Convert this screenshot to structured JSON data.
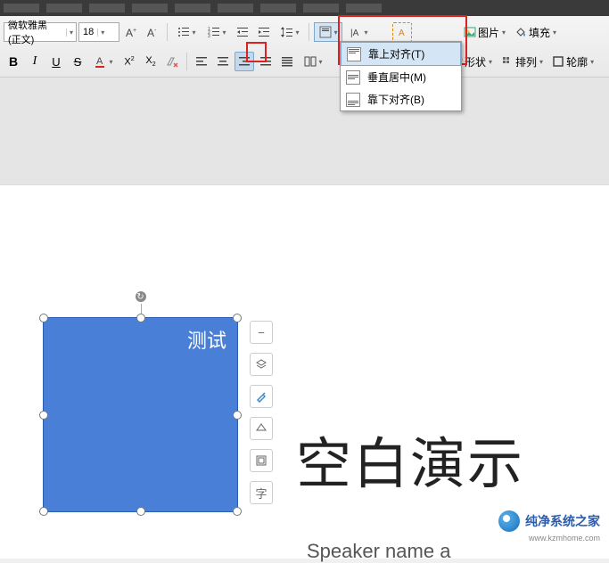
{
  "font": {
    "name": "微软雅黑 (正文)",
    "size": "18"
  },
  "dropdown": {
    "alignTop": "靠上对齐(T)",
    "alignMiddle": "垂直居中(M)",
    "alignBottom": "靠下对齐(B)"
  },
  "ribbonRight": {
    "picture": "图片",
    "shape": "形状",
    "fill": "填充",
    "arrange": "排列",
    "outline": "轮廓"
  },
  "shapeText": "测试",
  "slideTitle": "空白演示",
  "speaker": "Speaker name a",
  "watermark": {
    "text": "纯净系统之家",
    "url": "www.kzmhome.com"
  }
}
